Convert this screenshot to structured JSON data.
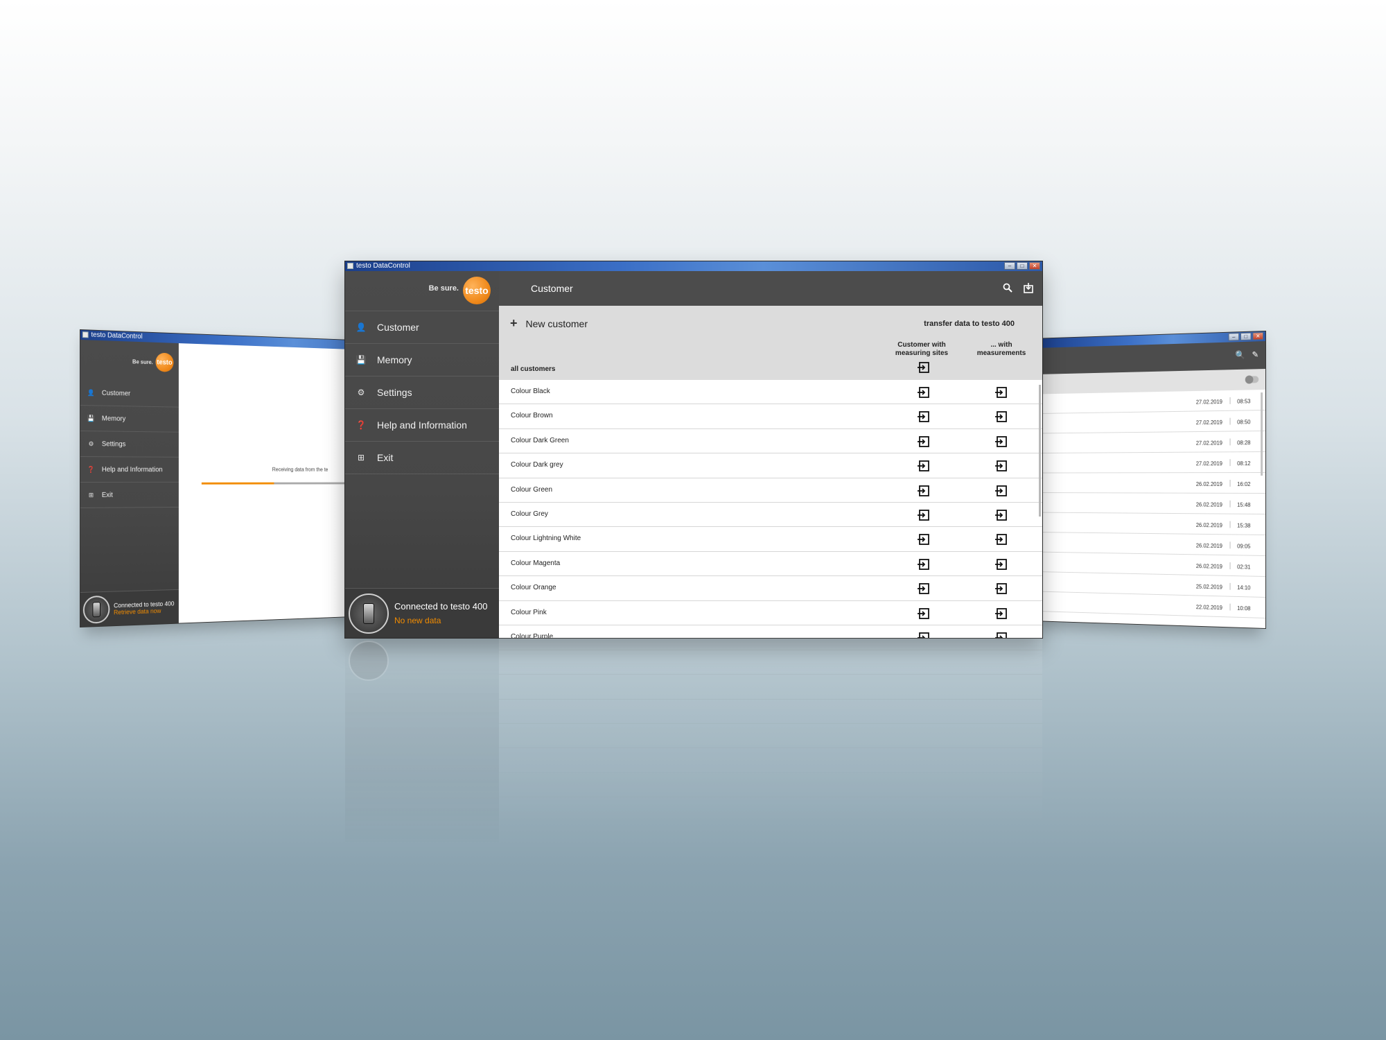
{
  "app": {
    "window_title": "testo DataControl",
    "brand_slogan": "Be sure.",
    "brand_logo": "testo",
    "accent_color": "#f28c00",
    "sidebar_color": "#4a4a4a"
  },
  "sidebar": {
    "items": [
      {
        "label": "Customer",
        "icon": "person-icon",
        "glyph": "👤"
      },
      {
        "label": "Memory",
        "icon": "save-icon",
        "glyph": "💾"
      },
      {
        "label": "Settings",
        "icon": "gear-icon",
        "glyph": "⚙"
      },
      {
        "label": "Help and Information",
        "icon": "help-icon",
        "glyph": "❓"
      },
      {
        "label": "Exit",
        "icon": "exit-icon",
        "glyph": "⊞"
      }
    ],
    "device": {
      "status": "Connected to testo 400",
      "sub_main": "No new data",
      "sub_left": "Retrieve data now"
    }
  },
  "main": {
    "topbar": {
      "title": "Customer",
      "search_icon": "search-icon",
      "export_icon": "export-icon"
    },
    "new_customer_label": "New customer",
    "transfer_label": "transfer data to testo 400",
    "col1_label_line1": "Customer with",
    "col1_label_line2": "measuring sites",
    "col2_label_line1": "... with",
    "col2_label_line2": "measurements",
    "all_customers_label": "all customers",
    "customers": [
      "Colour Black",
      "Colour Brown",
      "Colour Dark Green",
      "Colour Dark grey",
      "Colour Green",
      "Colour Grey",
      "Colour Lightning White",
      "Colour Magenta",
      "Colour Orange",
      "Colour Pink",
      "Colour Purple"
    ]
  },
  "left_window": {
    "receiving_text": "Receiving data from the te",
    "progress": 0.39
  },
  "right_window": {
    "rows": [
      {
        "date": "27.02.2019",
        "time": "08:53"
      },
      {
        "date": "27.02.2019",
        "time": "08:50"
      },
      {
        "date": "27.02.2019",
        "time": "08:28"
      },
      {
        "date": "27.02.2019",
        "time": "08:12"
      },
      {
        "date": "26.02.2019",
        "time": "16:02"
      },
      {
        "date": "26.02.2019",
        "time": "15:48"
      },
      {
        "date": "26.02.2019",
        "time": "15:38"
      },
      {
        "date": "26.02.2019",
        "time": "09:05"
      },
      {
        "date": "26.02.2019",
        "time": "02:31"
      },
      {
        "date": "25.02.2019",
        "time": "14:10"
      },
      {
        "date": "22.02.2019",
        "time": "10:08"
      }
    ]
  }
}
